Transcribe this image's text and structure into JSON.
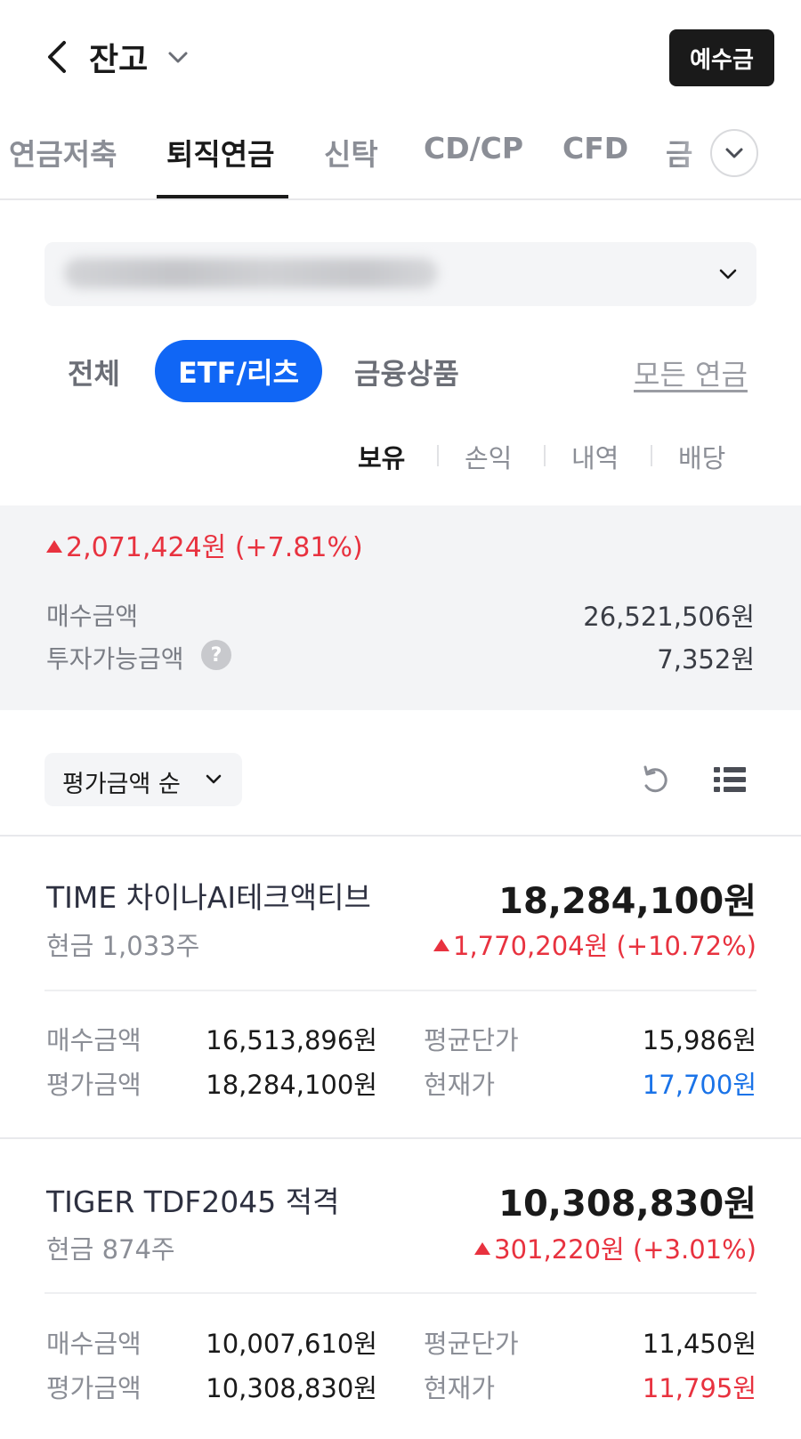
{
  "header": {
    "title": "잔고",
    "deposit_button": "예수금"
  },
  "tabs": [
    {
      "label": "연금저축"
    },
    {
      "label": "퇴직연금"
    },
    {
      "label": "신탁"
    },
    {
      "label": "CD/CP"
    },
    {
      "label": "CFD"
    },
    {
      "label": "금"
    }
  ],
  "active_tab": "퇴직연금",
  "filters": {
    "all": "전체",
    "etf": "ETF/리츠",
    "financial_products": "금융상품",
    "all_pension_link": "모든 연금"
  },
  "subtabs": [
    {
      "label": "보유"
    },
    {
      "label": "손익"
    },
    {
      "label": "내역"
    },
    {
      "label": "배당"
    }
  ],
  "summary": {
    "profit": "2,071,424원 (+7.81%)",
    "purchase_label": "매수금액",
    "purchase_value": "26,521,506원",
    "available_label": "투자가능금액",
    "available_value": "7,352원",
    "help_symbol": "?"
  },
  "sort": {
    "label": "평가금액 순"
  },
  "holdings": [
    {
      "name": "TIME 차이나AI테크액티브",
      "value": "18,284,100원",
      "qty": "현금 1,033주",
      "profit": "1,770,204원 (+10.72%)",
      "purchase_label": "매수금액",
      "purchase_value": "16,513,896원",
      "avg_price_label": "평균단가",
      "avg_price_value": "15,986원",
      "eval_label": "평가금액",
      "eval_value": "18,284,100원",
      "current_label": "현재가",
      "current_value": "17,700원"
    },
    {
      "name": "TIGER TDF2045 적격",
      "value": "10,308,830원",
      "qty": "현금 874주",
      "profit": "301,220원 (+3.01%)",
      "purchase_label": "매수금액",
      "purchase_value": "10,007,610원",
      "avg_price_label": "평균단가",
      "avg_price_value": "11,450원",
      "eval_label": "평가금액",
      "eval_value": "10,308,830원",
      "current_label": "현재가",
      "current_value": "11,795원"
    }
  ],
  "colors": {
    "accent_blue": "#1066f5",
    "profit_red": "#e8323f",
    "price_blue": "#1a73e8"
  },
  "icons": [
    "back-arrow-icon",
    "chevron-down-icon",
    "refresh-icon",
    "list-view-icon",
    "help-icon"
  ]
}
